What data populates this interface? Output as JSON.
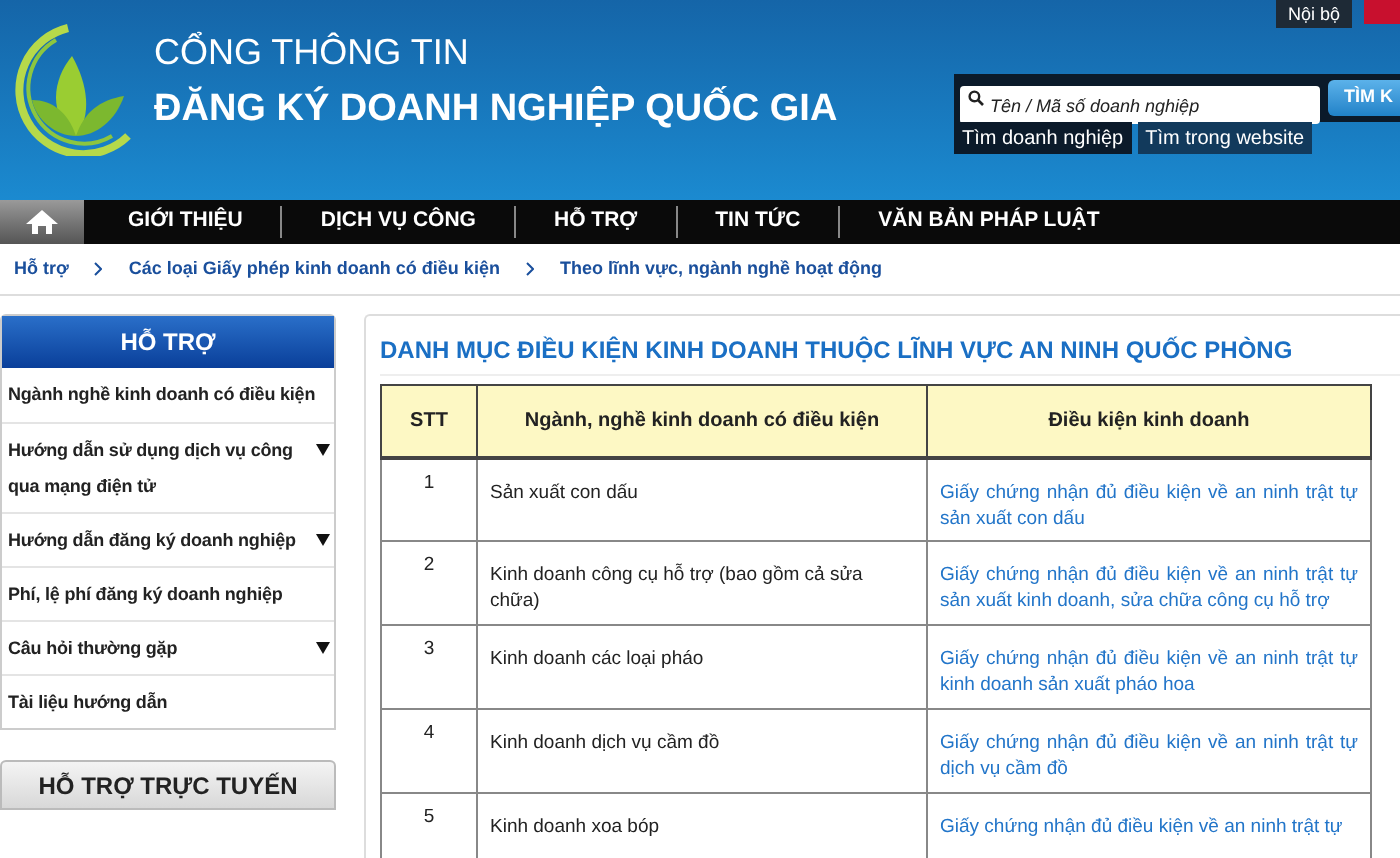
{
  "header": {
    "top_links": [
      "Nội bộ"
    ],
    "subtitle": "CỔNG THÔNG TIN",
    "title": "ĐĂNG KÝ DOANH NGHIỆP QUỐC GIA",
    "search": {
      "placeholder": "Tên / Mã số doanh nghiệp",
      "button": "TÌM K"
    },
    "search_modes": [
      {
        "label": "Tìm doanh nghiệp",
        "selected": true
      },
      {
        "label": "Tìm trong website",
        "selected": false
      }
    ]
  },
  "nav": {
    "items": [
      {
        "label": "GIỚI THIỆU"
      },
      {
        "label": "DỊCH VỤ CÔNG"
      },
      {
        "label": "HỖ TRỢ"
      },
      {
        "label": "TIN TỨC"
      },
      {
        "label": "VĂN BẢN PHÁP LUẬT"
      }
    ]
  },
  "breadcrumb": [
    "Hỗ trợ",
    "Các loại Giấy phép kinh doanh có điều kiện",
    "Theo lĩnh vực, ngành nghề hoạt động"
  ],
  "sidebar": {
    "title": "HỖ TRỢ",
    "items": [
      {
        "label": "Ngành nghề kinh doanh có điều kiện",
        "expandable": false
      },
      {
        "label": "Hướng dẫn sử dụng dịch vụ công qua mạng điện tử",
        "expandable": true
      },
      {
        "label": "Hướng dẫn đăng ký doanh nghiệp",
        "expandable": true
      },
      {
        "label": "Phí, lệ phí đăng ký doanh nghiệp",
        "expandable": false
      },
      {
        "label": "Câu hỏi thường gặp",
        "expandable": true
      },
      {
        "label": "Tài liệu hướng dẫn",
        "expandable": false
      }
    ],
    "online_support_title": "HỖ TRỢ TRỰC TUYẾN"
  },
  "content": {
    "title": "DANH MỤC ĐIỀU KIỆN KINH DOANH THUỘC LĨNH VỰC AN NINH QUỐC PHÒNG",
    "table": {
      "columns": [
        "STT",
        "Ngành, nghề kinh doanh có điều kiện",
        "Điều kiện kinh doanh"
      ],
      "rows": [
        [
          "1",
          "Sản xuất con dấu",
          "Giấy chứng nhận đủ điều kiện về an ninh trật tự sản xuất con dấu"
        ],
        [
          "2",
          "Kinh doanh công cụ hỗ trợ (bao gồm cả sửa chữa)",
          "Giấy chứng nhận đủ điều kiện về an ninh trật tự sản xuất kinh doanh, sửa chữa công cụ hỗ trợ"
        ],
        [
          "3",
          "Kinh doanh các loại pháo",
          "Giấy chứng nhận đủ điều kiện về an ninh trật tự kinh doanh sản xuất pháo hoa"
        ],
        [
          "4",
          "Kinh doanh dịch vụ cầm đồ",
          "Giấy chứng nhận đủ điều kiện về an ninh trật tự dịch vụ cầm đồ"
        ],
        [
          "5",
          "Kinh doanh xoa bóp",
          "Giấy chứng nhận đủ điều kiện về an ninh trật tự"
        ]
      ]
    }
  }
}
